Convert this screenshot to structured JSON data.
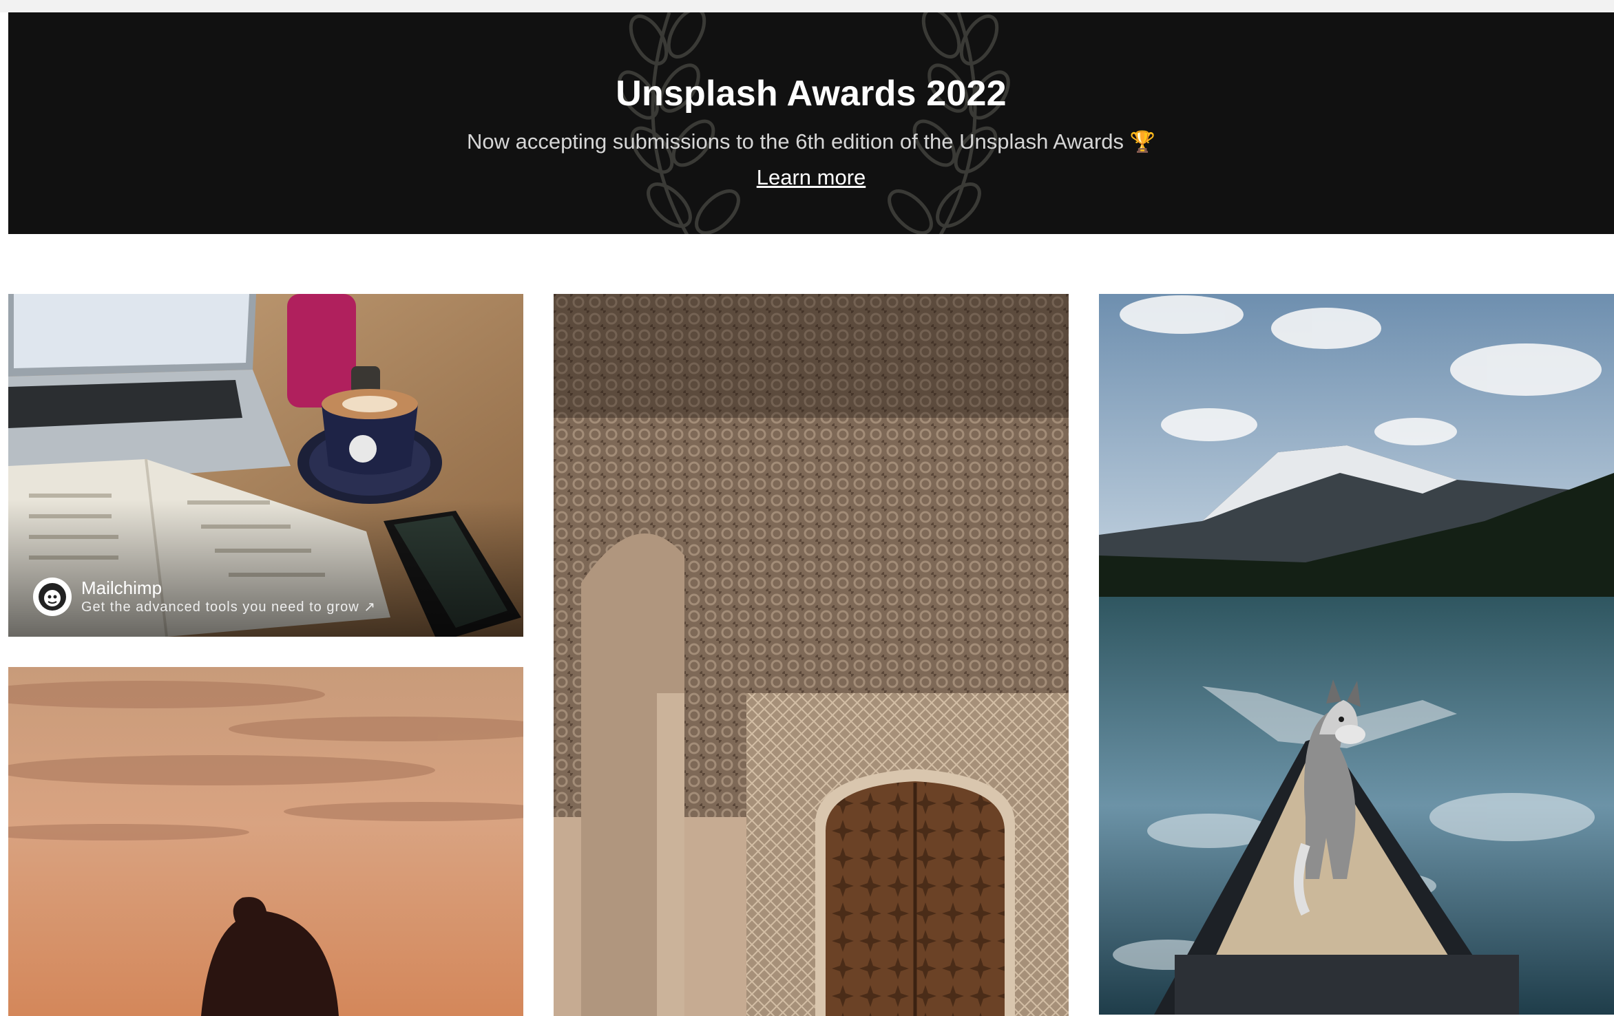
{
  "banner": {
    "title": "Unsplash Awards 2022",
    "subtitle": "Now accepting submissions to the 6th edition of the Unsplash Awards",
    "trophy_icon": "🏆",
    "link_label": "Learn more"
  },
  "photos": {
    "desk": {
      "sponsor_name": "Mailchimp",
      "sponsor_tagline": "Get the advanced tools you need to grow ↗"
    }
  },
  "colors": {
    "banner_bg": "#111111",
    "page_bg": "#ffffff"
  }
}
